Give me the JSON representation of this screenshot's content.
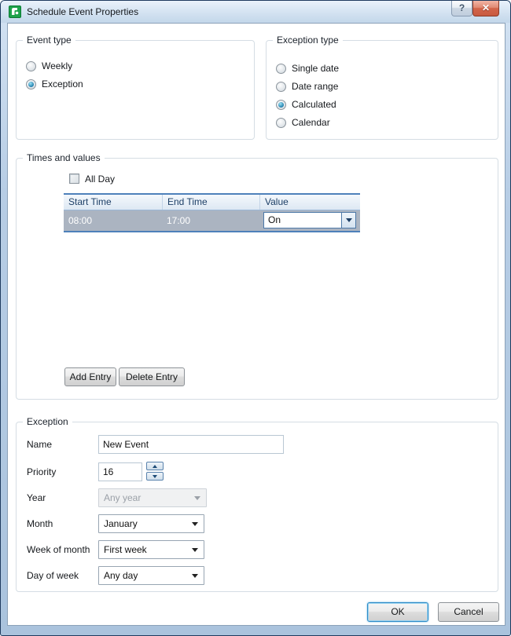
{
  "window": {
    "title": "Schedule Event Properties",
    "help_glyph": "?",
    "close_glyph": "✕"
  },
  "event_type": {
    "title": "Event type",
    "options": [
      {
        "label": "Weekly",
        "selected": false
      },
      {
        "label": "Exception",
        "selected": true
      }
    ]
  },
  "exception_type": {
    "title": "Exception type",
    "options": [
      {
        "label": "Single date",
        "selected": false
      },
      {
        "label": "Date range",
        "selected": false
      },
      {
        "label": "Calculated",
        "selected": true
      },
      {
        "label": "Calendar",
        "selected": false
      }
    ]
  },
  "times_and_values": {
    "title": "Times and values",
    "all_day_label": "All Day",
    "all_day_checked": false,
    "table": {
      "columns": [
        "Start Time",
        "End Time",
        "Value"
      ],
      "rows": [
        {
          "start_time": "08:00",
          "end_time": "17:00",
          "value": "On",
          "selected": true
        }
      ]
    },
    "add_button": "Add Entry",
    "delete_button": "Delete Entry"
  },
  "exception": {
    "title": "Exception",
    "fields": [
      {
        "label": "Name",
        "value": "New Event",
        "type": "text"
      },
      {
        "label": "Priority",
        "value": "16",
        "type": "spinner"
      },
      {
        "label": "Year",
        "value": "Any year",
        "type": "select",
        "disabled": true
      },
      {
        "label": "Month",
        "value": "January",
        "type": "select",
        "disabled": false
      },
      {
        "label": "Week of month",
        "value": "First week",
        "type": "select",
        "disabled": false
      },
      {
        "label": "Day of week",
        "value": "Any day",
        "type": "select",
        "disabled": false
      }
    ]
  },
  "footer": {
    "ok_label": "OK",
    "cancel_label": "Cancel"
  },
  "colors": {
    "accent_blue": "#4e81ba",
    "selected_row_bg": "#abb4c1",
    "titlebar_glass": "#c9dcef",
    "close_button_red": "#d3654b",
    "ok_focus_border": "#2e8bc7",
    "icon_green": "#1ea34b",
    "header_text": "#1d3f66"
  }
}
